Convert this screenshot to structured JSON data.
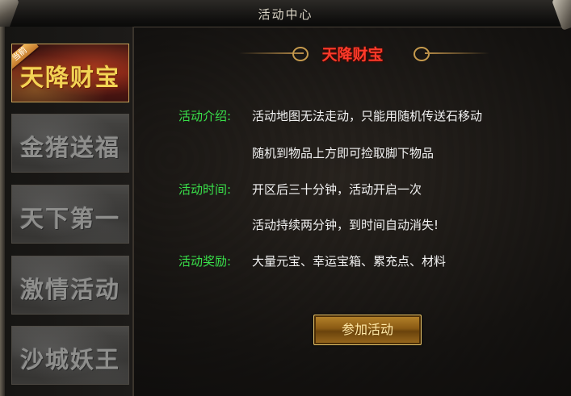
{
  "window": {
    "title": "活动中心"
  },
  "sidebar": {
    "active_badge": "当前",
    "tabs": [
      {
        "label": "天降财宝",
        "active": true
      },
      {
        "label": "金猪送福",
        "active": false
      },
      {
        "label": "天下第一",
        "active": false
      },
      {
        "label": "激情活动",
        "active": false
      },
      {
        "label": "沙城妖王",
        "active": false
      }
    ]
  },
  "event": {
    "title": "天降财宝",
    "intro_label": "活动介绍:",
    "intro_line1": "活动地图无法走动，只能用随机传送石移动",
    "intro_line2": "随机到物品上方即可捡取脚下物品",
    "time_label": "活动时间:",
    "time_line1": "开区后三十分钟，活动开启一次",
    "time_line2": "活动持续两分钟，到时间自动消失!",
    "reward_label": "活动奖励:",
    "reward_line": "大量元宝、幸运宝箱、累充点、材料",
    "join_button": "参加活动"
  },
  "colors": {
    "label_green": "#39e04a",
    "title_red": "#ff3a2a",
    "active_tab_gold": "#f3d455",
    "button_gold": "#b7852b"
  }
}
